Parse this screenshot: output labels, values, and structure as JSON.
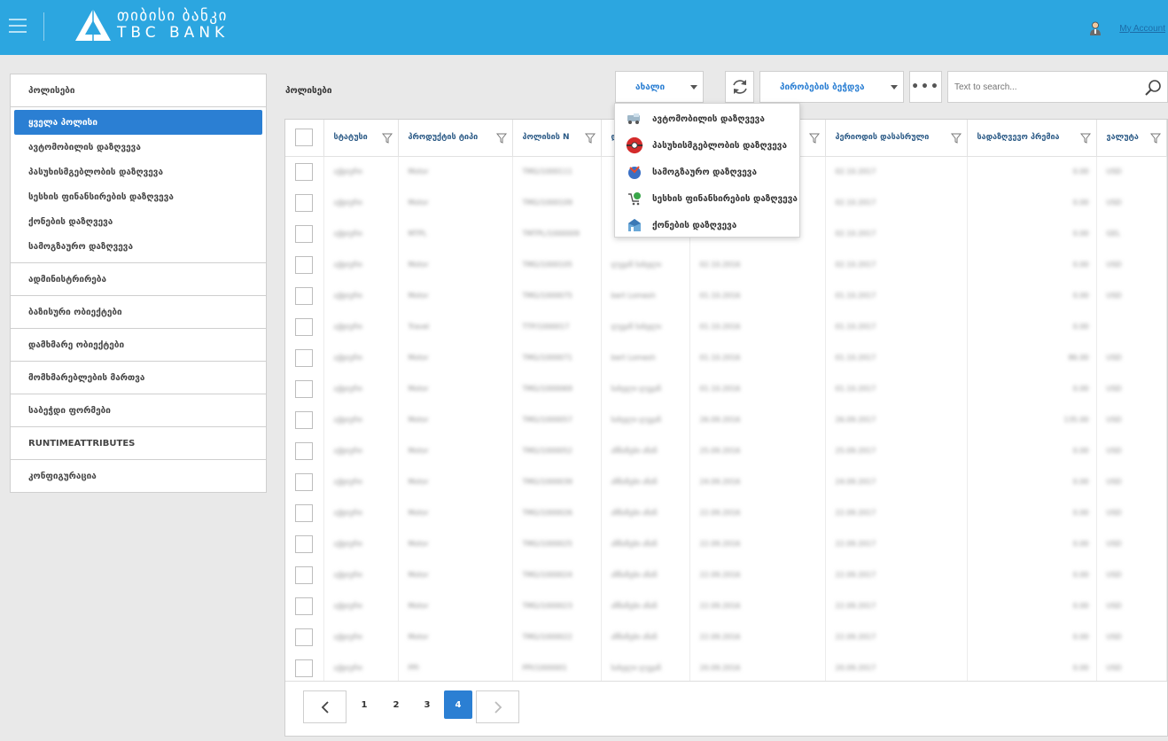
{
  "header": {
    "logo_ka": "თიბისი ბანკი",
    "logo_en": "TBC BANK",
    "account_label": "My Account",
    "bg_color": "#2ca6e0"
  },
  "sidebar": {
    "title": "პოლისები",
    "sub_items": [
      {
        "label": "ყველა პოლისი",
        "active": true
      },
      {
        "label": "ავტომობილის დაზღვევა"
      },
      {
        "label": "პასუხისმგებლობის დაზღვევა"
      },
      {
        "label": "სესხის ფინანსირების დაზღვევა"
      },
      {
        "label": "ქონების დაზღვევა"
      },
      {
        "label": "სამოგზაურო დაზღვევა"
      }
    ],
    "sections": [
      {
        "label": "ადმინისტრირება"
      },
      {
        "label": "ბაზისური ობიექტები"
      },
      {
        "label": "დამხმარე ობიექტები"
      },
      {
        "label": "მომხმარებლების მართვა"
      },
      {
        "label": "საბეჭდი ფორმები"
      },
      {
        "label": "RUNTIMEATTRIBUTES"
      },
      {
        "label": "კონფიგურაცია"
      }
    ]
  },
  "toolbar": {
    "page_title": "პოლისები",
    "new_label": "ახალი",
    "print_label": "პირობების ბეჭდვა",
    "more_label": "•••",
    "search_placeholder": "Text to search..."
  },
  "new_menu": [
    {
      "label": "ავტომობილის დაზღვევა",
      "icon": "car-icon"
    },
    {
      "label": "პასუხისმგებლობის დაზღვევა",
      "icon": "liability-icon"
    },
    {
      "label": "სამოგზაურო დაზღვევა",
      "icon": "travel-icon"
    },
    {
      "label": "სესხის ფინანსირების დაზღვევა",
      "icon": "loan-icon"
    },
    {
      "label": "ქონების დაზღვევა",
      "icon": "property-icon"
    }
  ],
  "table": {
    "columns": [
      "სტატუსი",
      "პროდუქტის ტიპი",
      "პოლისის N",
      "დ",
      "",
      "პერიოდის დასასრული",
      "სადაზღვევო პრემია",
      "ვალუტა"
    ],
    "rows": [
      [
        "აქტიური",
        "Motor",
        "TMG/1000111",
        "",
        "",
        "02.10.2017",
        "0.00",
        "USD"
      ],
      [
        "აქტიური",
        "Motor",
        "TMG/1000109",
        "",
        "",
        "02.10.2017",
        "0.00",
        "USD"
      ],
      [
        "აქტიური",
        "MTPL",
        "TMTPL/1000009",
        "",
        "",
        "02.10.2017",
        "0.00",
        "GEL"
      ],
      [
        "აქტიური",
        "Motor",
        "TMG/1000105",
        "ლევან სახელი",
        "02.10.2016",
        "02.10.2017",
        "0.00",
        "USD"
      ],
      [
        "აქტიური",
        "Motor",
        "TMG/1000075",
        "bert Lomesh",
        "01.10.2016",
        "01.10.2017",
        "0.00",
        "USD"
      ],
      [
        "აქტიური",
        "Travel",
        "TTP/1000017",
        "ლევან სახელი",
        "01.10.2016",
        "01.10.2017",
        "0.00",
        ""
      ],
      [
        "აქტიური",
        "Motor",
        "TMG/1000071",
        "bert Lomesh",
        "01.10.2016",
        "01.10.2017",
        "86.00",
        "USD"
      ],
      [
        "აქტიური",
        "Motor",
        "TMG/1000069",
        "სახელი ლევან",
        "01.10.2016",
        "01.10.2017",
        "0.00",
        "USD"
      ],
      [
        "აქტიური",
        "Motor",
        "TMG/1000057",
        "სახელი ლევან",
        "26.09.2016",
        "26.09.2017",
        "135.00",
        "USD"
      ],
      [
        "აქტიური",
        "Motor",
        "TMG/1000052",
        "ანნანები ანან",
        "25.09.2016",
        "25.09.2017",
        "0.00",
        "USD"
      ],
      [
        "აქტიური",
        "Motor",
        "TMG/1000039",
        "ანნანები ანან",
        "24.09.2016",
        "24.09.2017",
        "0.00",
        "USD"
      ],
      [
        "აქტიური",
        "Motor",
        "TMG/1000026",
        "ანნანები ანან",
        "22.09.2016",
        "22.09.2017",
        "0.00",
        "USD"
      ],
      [
        "აქტიური",
        "Motor",
        "TMG/1000025",
        "ანნანები ანან",
        "22.09.2016",
        "22.09.2017",
        "0.00",
        "USD"
      ],
      [
        "აქტიური",
        "Motor",
        "TMG/1000024",
        "ანნანები ანან",
        "22.09.2016",
        "22.09.2017",
        "0.00",
        "USD"
      ],
      [
        "აქტიური",
        "Motor",
        "TMG/1000023",
        "ანნანები ანან",
        "22.09.2016",
        "22.09.2017",
        "0.00",
        "USD"
      ],
      [
        "აქტიური",
        "Motor",
        "TMG/1000022",
        "ანნანები ანან",
        "22.09.2016",
        "22.09.2017",
        "0.00",
        "USD"
      ],
      [
        "აქტიური",
        "PPI",
        "PPI/1000001",
        "სახელი ლევან",
        "20.09.2016",
        "20.09.2017",
        "0.00",
        "USD"
      ]
    ]
  },
  "pager": {
    "pages": [
      "1",
      "2",
      "3",
      "4"
    ],
    "current_page": 4
  }
}
